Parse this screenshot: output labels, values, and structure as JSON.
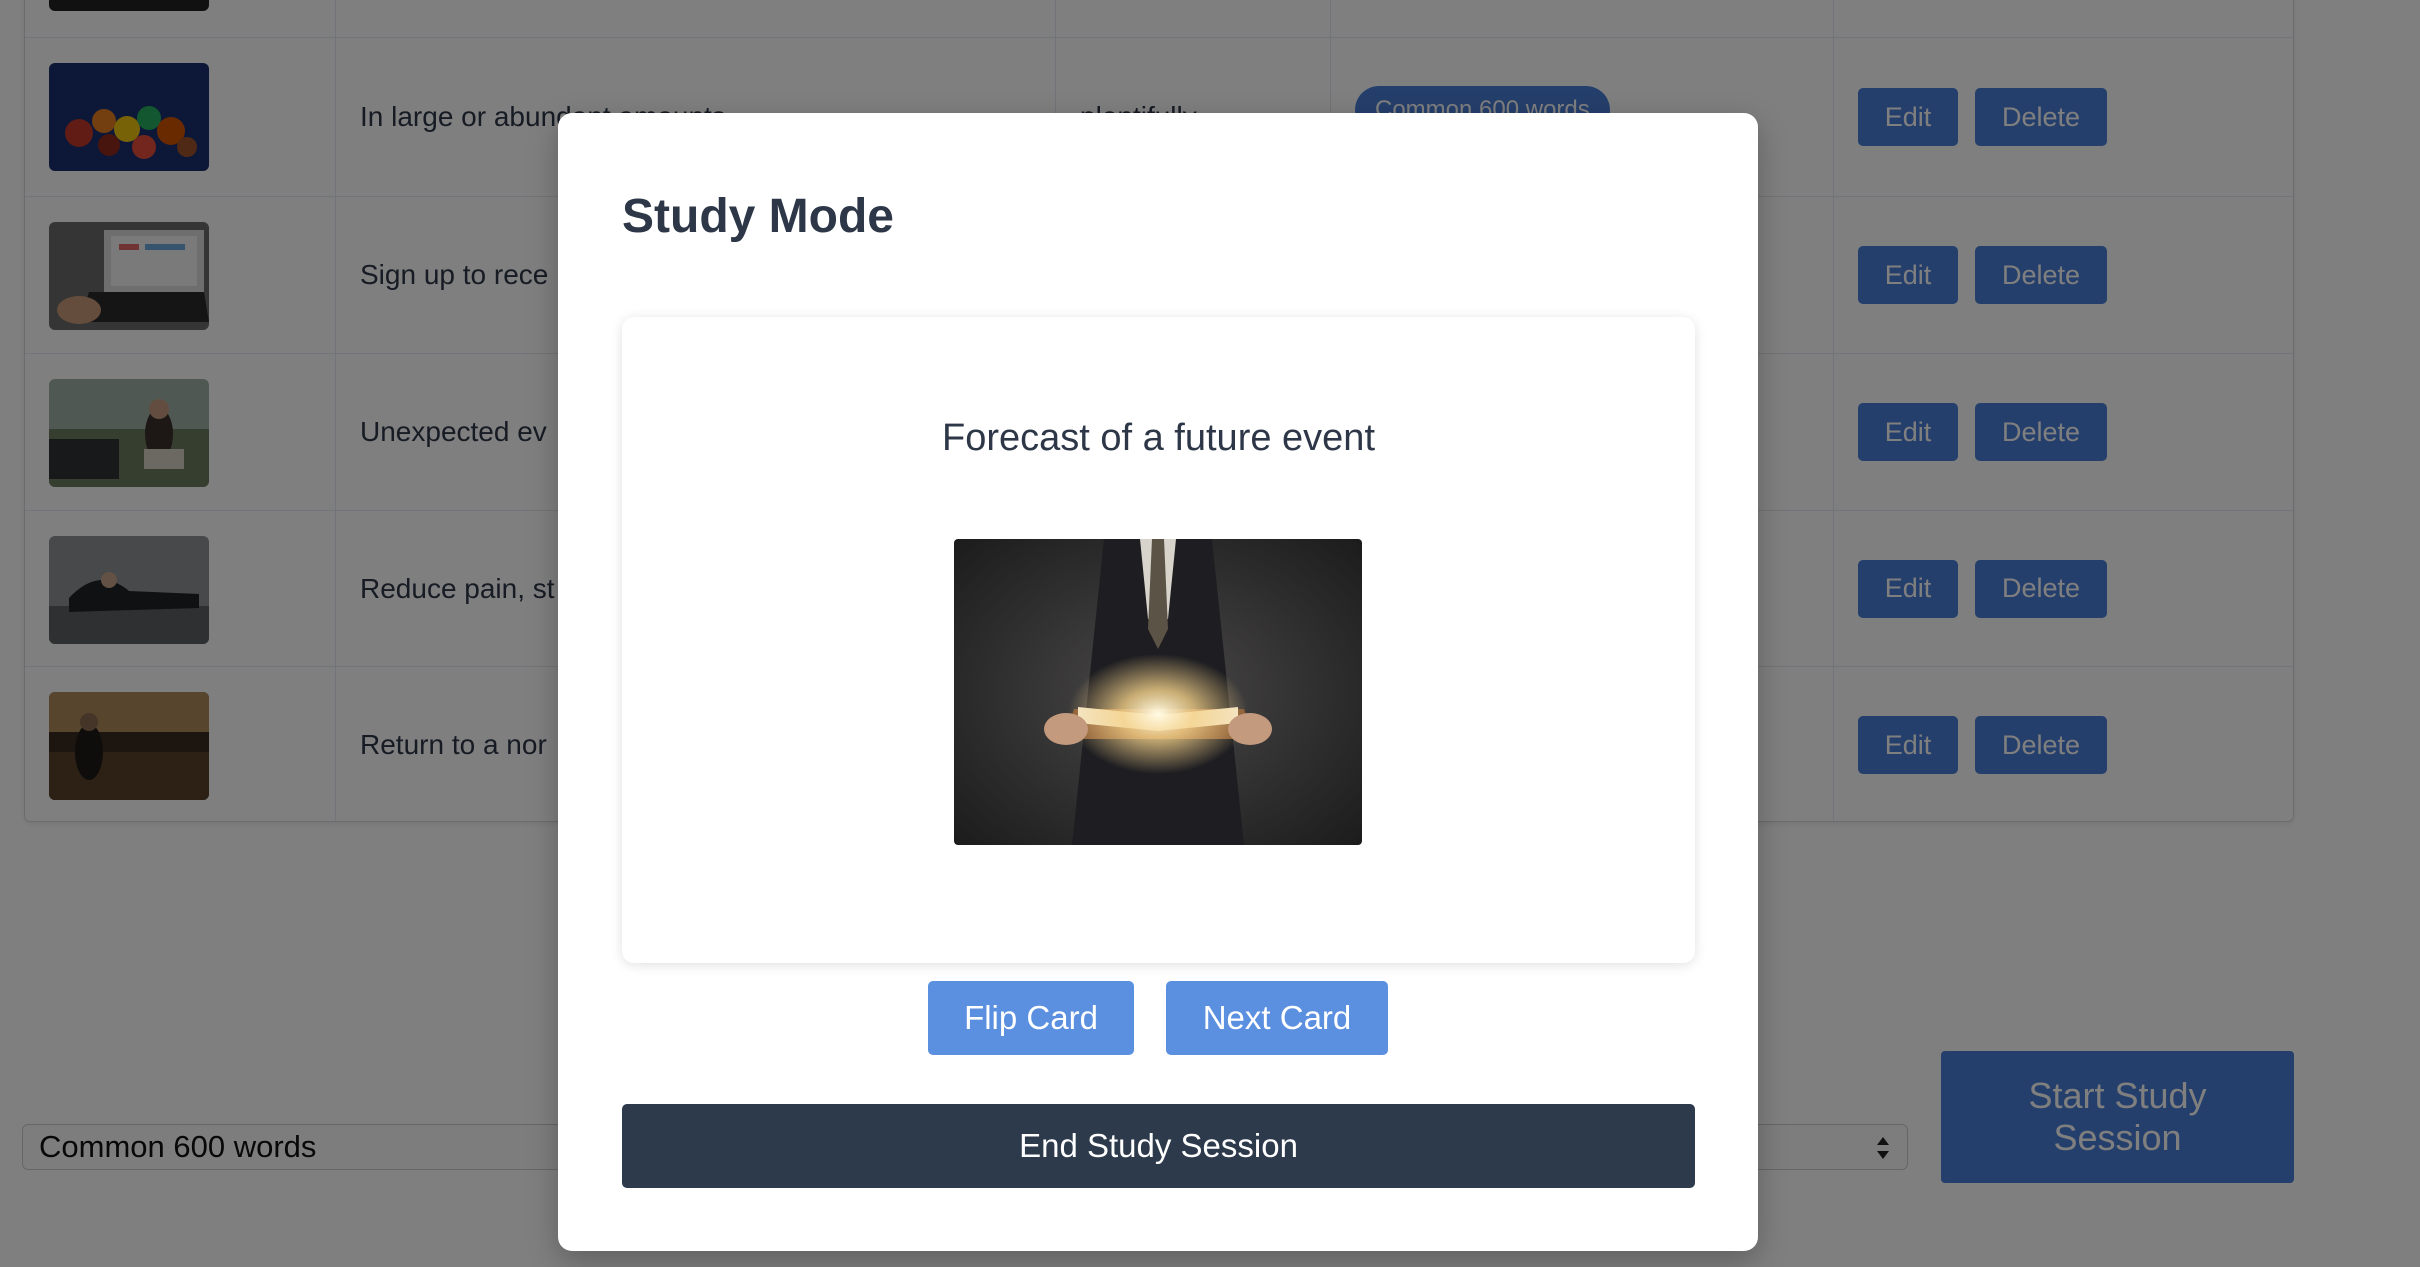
{
  "table": {
    "rows": [
      {
        "definition": "In large or abundant amounts",
        "word": "plentifully",
        "tag": "Common 600 words",
        "thumb": "fruit-vegetables"
      },
      {
        "definition": "Sign up to rece",
        "word": "",
        "tag": "",
        "thumb": "laptop"
      },
      {
        "definition": "Unexpected ev",
        "word": "",
        "tag": "",
        "thumb": "car-breakdown"
      },
      {
        "definition": "Reduce pain, st",
        "word": "",
        "tag": "",
        "thumb": "stretching"
      },
      {
        "definition": "Return to a nor",
        "word": "",
        "tag": "",
        "thumb": "sunset-field"
      }
    ],
    "edit_label": "Edit",
    "delete_label": "Delete"
  },
  "footer": {
    "deck_select_value": "Common 600 words",
    "start_label": "Start Study Session"
  },
  "modal": {
    "title": "Study Mode",
    "card_text": "Forecast of a future event",
    "card_image": "man-holding-glowing-book",
    "flip_label": "Flip Card",
    "next_label": "Next Card",
    "end_label": "End Study Session"
  },
  "colors": {
    "accent": "#4a7fd8",
    "accent_light": "#5b8fe0",
    "dark_button": "#2d3a4c",
    "text": "#2d3748"
  }
}
